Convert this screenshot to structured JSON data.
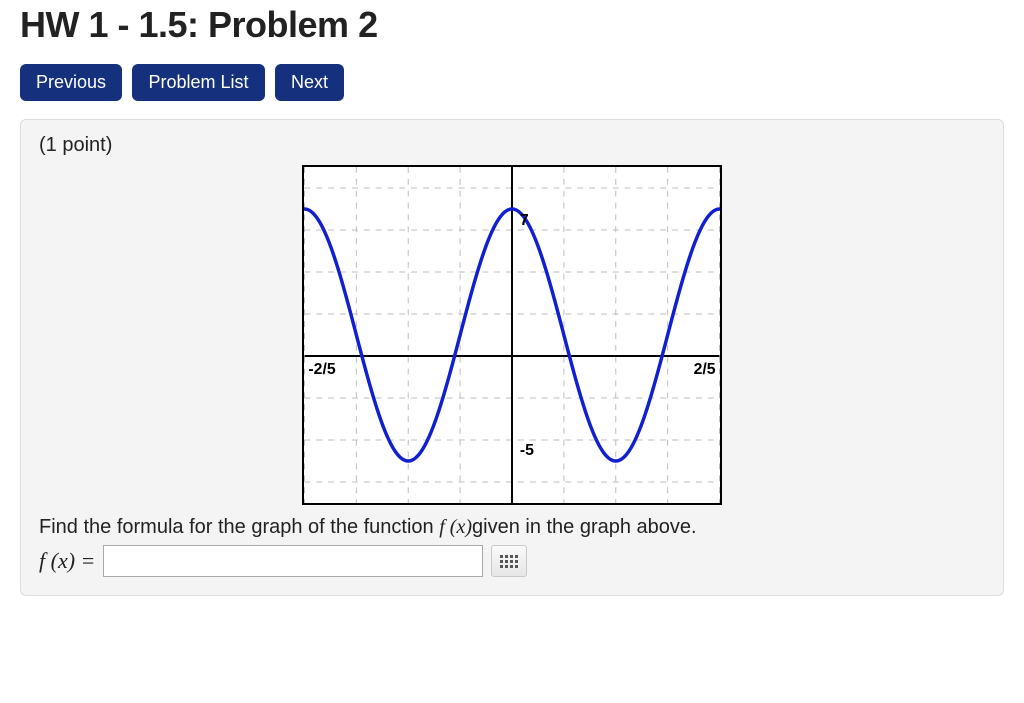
{
  "title": "HW 1 - 1.5: Problem 2",
  "nav": {
    "previous": "Previous",
    "problem_list": "Problem List",
    "next": "Next"
  },
  "points_label": "(1 point)",
  "prompt_before": "Find the formula for the graph of the function ",
  "prompt_fx": "f (x)",
  "prompt_after": "given in the graph above.",
  "lhs": "f (x) = ",
  "answer_value": "",
  "chart_data": {
    "type": "line",
    "title": "",
    "xlabel": "",
    "ylabel": "",
    "xlim": [
      -0.4,
      0.4
    ],
    "ylim": [
      -7,
      9
    ],
    "x_ticks": [
      -0.4,
      0.4
    ],
    "x_tick_labels": [
      "-2/5",
      "2/5"
    ],
    "y_ticks": [
      -5,
      7
    ],
    "y_tick_labels": [
      "-5",
      "7"
    ],
    "curve": {
      "description": "sinusoid y = 1 + 6*cos(5*pi*x)",
      "amplitude": 6,
      "vertical_shift": 1,
      "period": 0.4,
      "max_value": 7,
      "min_value": -5,
      "sample_x": [
        -0.4,
        -0.36,
        -0.32,
        -0.28,
        -0.24,
        -0.2,
        -0.16,
        -0.12,
        -0.08,
        -0.04,
        0.0,
        0.04,
        0.08,
        0.12,
        0.16,
        0.2,
        0.24,
        0.28,
        0.32,
        0.36,
        0.4
      ],
      "sample_y": [
        7.0,
        5.85,
        2.85,
        -0.85,
        -3.85,
        -5.0,
        -3.85,
        -0.85,
        2.85,
        5.85,
        7.0,
        5.85,
        2.85,
        -0.85,
        -3.85,
        -5.0,
        -3.85,
        -0.85,
        2.85,
        5.85,
        7.0
      ]
    }
  }
}
